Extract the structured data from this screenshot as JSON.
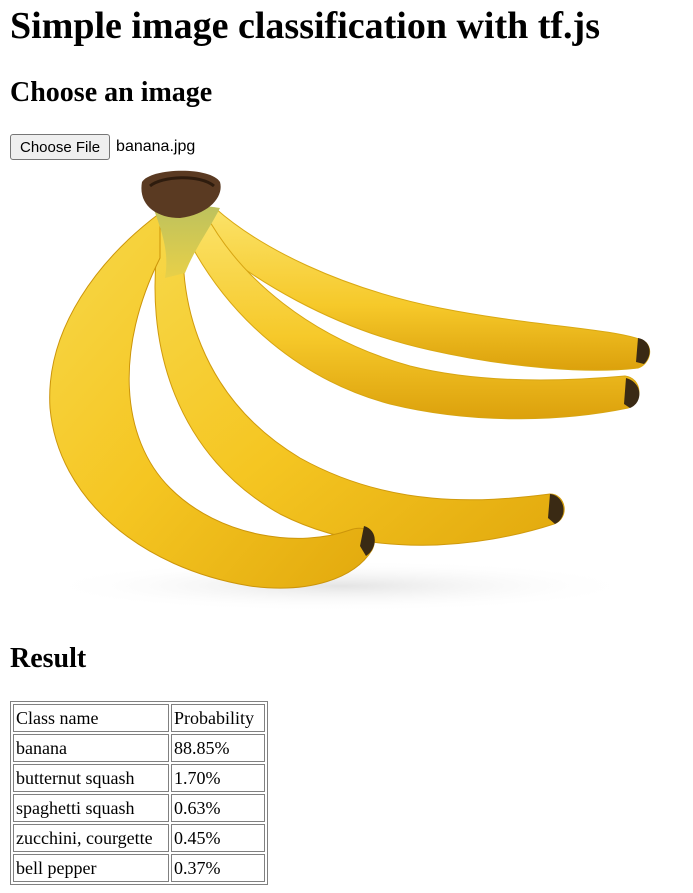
{
  "page": {
    "title": "Simple image classification with tf.js",
    "choose_heading": "Choose an image",
    "file_input": {
      "button_label": "Choose File",
      "file_name": "banana.jpg"
    },
    "image_subject": "bunch of bananas",
    "result_heading": "Result"
  },
  "results_table": {
    "headers": [
      "Class name",
      "Probability"
    ],
    "rows": [
      {
        "class_name": "banana",
        "probability": "88.85%"
      },
      {
        "class_name": "butternut squash",
        "probability": "1.70%"
      },
      {
        "class_name": "spaghetti squash",
        "probability": "0.63%"
      },
      {
        "class_name": "zucchini, courgette",
        "probability": "0.45%"
      },
      {
        "class_name": "bell pepper",
        "probability": "0.37%"
      }
    ]
  }
}
